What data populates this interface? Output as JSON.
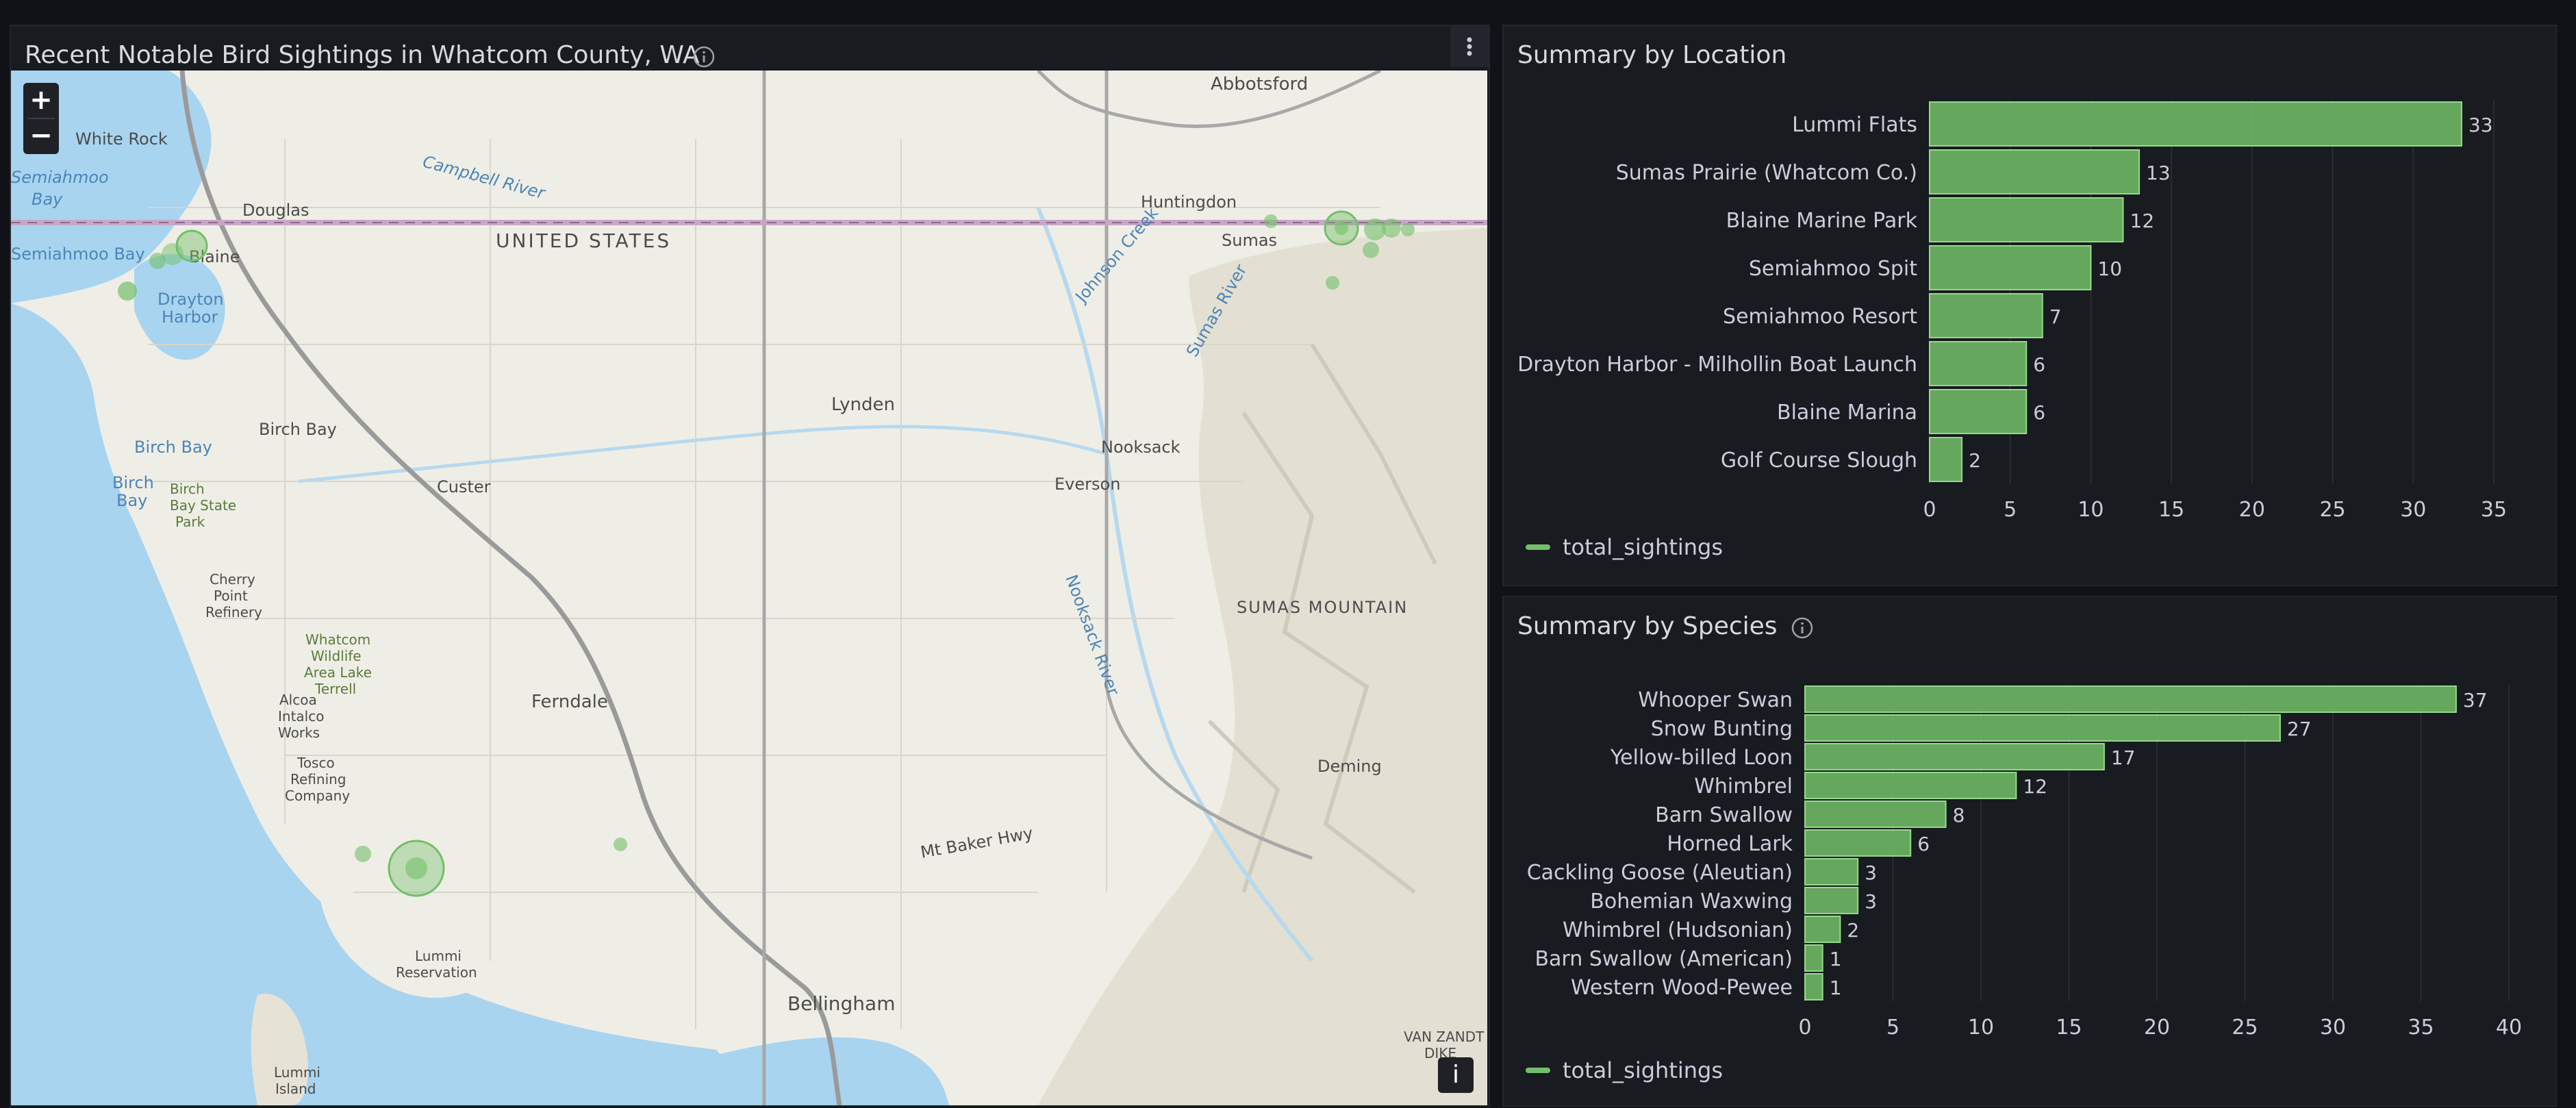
{
  "map_panel": {
    "title": "Recent Notable Bird Sightings in Whatcom County, WA",
    "zoom_in": "+",
    "zoom_out": "−",
    "attribution_button": "i",
    "place_labels": [
      "Abbotsford",
      "White Rock",
      "Semiahmoo Bay",
      "Douglas",
      "Huntingdon",
      "UNITED STATES",
      "Blaine",
      "Sumas",
      "Drayton Harbor",
      "Lynden",
      "Birch Bay",
      "Birch Bay State Park",
      "Custer",
      "Nooksack",
      "Everson",
      "SUMAS MOUNTAIN",
      "Cherry Point Refinery",
      "Whatcom Wildlife Area Lake Terrell",
      "Alcoa Intalco Works",
      "Ferndale",
      "Tosco Refining Company",
      "Deming",
      "Mt Baker Hwy",
      "Lummi Reservation",
      "Bellingham",
      "Lummi Island",
      "VAN ZANDT DIKE",
      "Johnson Creek",
      "Sumas River",
      "Nooksack River",
      "Campbell River"
    ],
    "colors": {
      "marker": "#73bf69",
      "water": "#a8d4f0",
      "land": "#efeee6",
      "road": "#b5b5b5"
    }
  },
  "location_panel": {
    "title": "Summary by Location",
    "legend": "total_sightings",
    "chart_data": {
      "type": "bar",
      "orientation": "horizontal",
      "categories": [
        "Lummi Flats",
        "Sumas Prairie (Whatcom Co.)",
        "Blaine Marine Park",
        "Semiahmoo Spit",
        "Semiahmoo Resort",
        "Drayton Harbor - Milhollin Boat Launch",
        "Blaine Marina",
        "Golf Course Slough"
      ],
      "series": [
        {
          "name": "total_sightings",
          "values": [
            33,
            13,
            12,
            10,
            7,
            6,
            6,
            2
          ]
        }
      ],
      "xlim": [
        0,
        35
      ],
      "ticks": [
        0,
        5,
        10,
        15,
        20,
        25,
        30,
        35
      ],
      "grid": true,
      "legend_position": "bottom-left"
    }
  },
  "species_panel": {
    "title": "Summary by Species",
    "legend": "total_sightings",
    "chart_data": {
      "type": "bar",
      "orientation": "horizontal",
      "categories": [
        "Whooper Swan",
        "Snow Bunting",
        "Yellow-billed Loon",
        "Whimbrel",
        "Barn Swallow",
        "Horned Lark",
        "Cackling Goose (Aleutian)",
        "Bohemian Waxwing",
        "Whimbrel (Hudsonian)",
        "Barn Swallow (American)",
        "Western Wood-Pewee"
      ],
      "series": [
        {
          "name": "total_sightings",
          "values": [
            37,
            27,
            17,
            12,
            8,
            6,
            3,
            3,
            2,
            1,
            1
          ]
        }
      ],
      "xlim": [
        0,
        40
      ],
      "ticks": [
        0,
        5,
        10,
        15,
        20,
        25,
        30,
        35,
        40
      ],
      "grid": true,
      "legend_position": "bottom-left"
    }
  },
  "colors": {
    "bar_fill": "#73bf69",
    "bar_border": "#96d98d",
    "legend": "#73bf69"
  }
}
